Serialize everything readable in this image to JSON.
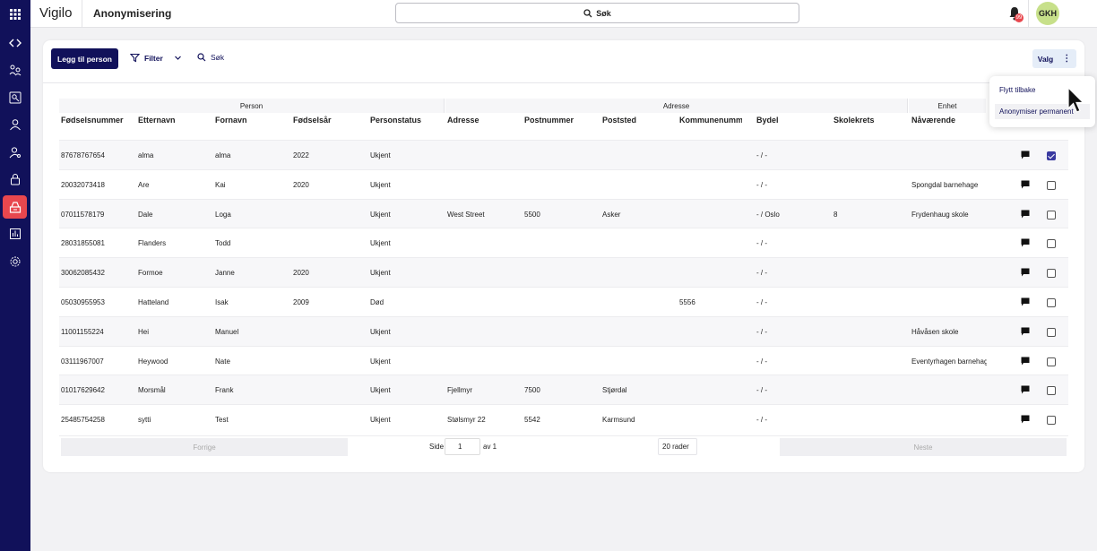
{
  "app": {
    "brand": "Vigilo",
    "page_title": "Anonymisering",
    "search_label": "Søk",
    "notification_count": "99",
    "user_initials": "GKH"
  },
  "toolbar": {
    "add_button": "Legg til person",
    "filter_label": "Filter",
    "search_label": "Søk",
    "options_label": "Valg"
  },
  "menu": {
    "items": [
      "Flytt tilbake",
      "Anonymiser permanent"
    ]
  },
  "table": {
    "groups": [
      "Person",
      "Adresse",
      "Enhet"
    ],
    "columns": [
      "Fødselsnummer",
      "Etternavn",
      "Fornavn",
      "Fødselsår",
      "Personstatus",
      "Adresse",
      "Postnummer",
      "Poststed",
      "Kommunenummer",
      "Bydel",
      "Skolekrets",
      "Nåværende"
    ],
    "rows": [
      {
        "fnr": "87678767654",
        "etternavn": "alma",
        "fornavn": "alma",
        "fodselsar": "2022",
        "status": "Ukjent",
        "adresse": "",
        "postnr": "",
        "poststed": "",
        "kommunenr": "",
        "bydel": "- / -",
        "skolekrets": "",
        "enhet": "",
        "checked": true
      },
      {
        "fnr": "20032073418",
        "etternavn": "Are",
        "fornavn": "Kai",
        "fodselsar": "2020",
        "status": "Ukjent",
        "adresse": "",
        "postnr": "",
        "poststed": "",
        "kommunenr": "",
        "bydel": "- / -",
        "skolekrets": "",
        "enhet": "Spongdal barnehage",
        "checked": false
      },
      {
        "fnr": "07011578179",
        "etternavn": "Dale",
        "fornavn": "Loga",
        "fodselsar": "",
        "status": "Ukjent",
        "adresse": "West Street",
        "postnr": "5500",
        "poststed": "Asker",
        "kommunenr": "",
        "bydel": "- / Oslo",
        "skolekrets": "8",
        "enhet": "Frydenhaug skole",
        "checked": false
      },
      {
        "fnr": "28031855081",
        "etternavn": "Flanders",
        "fornavn": "Todd",
        "fodselsar": "",
        "status": "Ukjent",
        "adresse": "",
        "postnr": "",
        "poststed": "",
        "kommunenr": "",
        "bydel": "- / -",
        "skolekrets": "",
        "enhet": "",
        "checked": false
      },
      {
        "fnr": "30062085432",
        "etternavn": "Formoe",
        "fornavn": "Janne",
        "fodselsar": "2020",
        "status": "Ukjent",
        "adresse": "",
        "postnr": "",
        "poststed": "",
        "kommunenr": "",
        "bydel": "- / -",
        "skolekrets": "",
        "enhet": "",
        "checked": false
      },
      {
        "fnr": "05030955953",
        "etternavn": "Hatteland",
        "fornavn": "Isak",
        "fodselsar": "2009",
        "status": "Død",
        "adresse": "",
        "postnr": "",
        "poststed": "",
        "kommunenr": "5556",
        "bydel": "- / -",
        "skolekrets": "",
        "enhet": "",
        "checked": false
      },
      {
        "fnr": "11001155224",
        "etternavn": "Hei",
        "fornavn": "Manuel",
        "fodselsar": "",
        "status": "Ukjent",
        "adresse": "",
        "postnr": "",
        "poststed": "",
        "kommunenr": "",
        "bydel": "- / -",
        "skolekrets": "",
        "enhet": "Håvåsen skole",
        "checked": false
      },
      {
        "fnr": "03111967007",
        "etternavn": "Heywood",
        "fornavn": "Nate",
        "fodselsar": "",
        "status": "Ukjent",
        "adresse": "",
        "postnr": "",
        "poststed": "",
        "kommunenr": "",
        "bydel": "- / -",
        "skolekrets": "",
        "enhet": "Eventyrhagen barnehage",
        "checked": false
      },
      {
        "fnr": "01017629642",
        "etternavn": "Morsmål",
        "fornavn": "Frank",
        "fodselsar": "",
        "status": "Ukjent",
        "adresse": "Fjellmyr",
        "postnr": "7500",
        "poststed": "Stjørdal",
        "kommunenr": "",
        "bydel": "- / -",
        "skolekrets": "",
        "enhet": "",
        "checked": false
      },
      {
        "fnr": "25485754258",
        "etternavn": "sytti",
        "fornavn": "Test",
        "fodselsar": "",
        "status": "Ukjent",
        "adresse": "Stølsmyr 22",
        "postnr": "5542",
        "poststed": "Karmsund",
        "kommunenr": "",
        "bydel": "- / -",
        "skolekrets": "",
        "enhet": "",
        "checked": false
      }
    ]
  },
  "pagination": {
    "prev_label": "Forrige",
    "page_label": "Side",
    "page_value": "1",
    "of_label": "av 1",
    "rows_label": "20 rader",
    "next_label": "Neste"
  },
  "colors": {
    "rail": "#11115a",
    "accent": "#e8474e",
    "primary_button": "#11115a",
    "avatar": "#c7e08a"
  }
}
